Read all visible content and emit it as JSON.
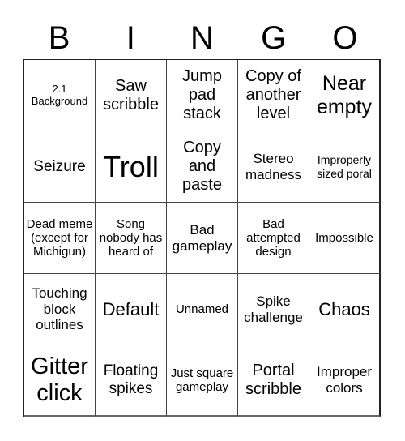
{
  "header": {
    "letters": [
      "B",
      "I",
      "N",
      "G",
      "O"
    ]
  },
  "cells": [
    "2.1 Background",
    "Saw scribble",
    "Jump pad stack",
    "Copy of another level",
    "Near empty",
    "Seizure",
    "Troll",
    "Copy and paste",
    "Stereo madness",
    "Improperly sized poral",
    "Dead meme (except for Michigun)",
    "Song nobody has heard of",
    "Bad gameplay",
    "Bad attempted design",
    "Impossible",
    "Touching block outlines",
    "Default",
    "Unnamed",
    "Spike challenge",
    "Chaos",
    "Gitter click",
    "Floating spikes",
    "Just square gameplay",
    "Portal scribble",
    "Improper colors"
  ]
}
